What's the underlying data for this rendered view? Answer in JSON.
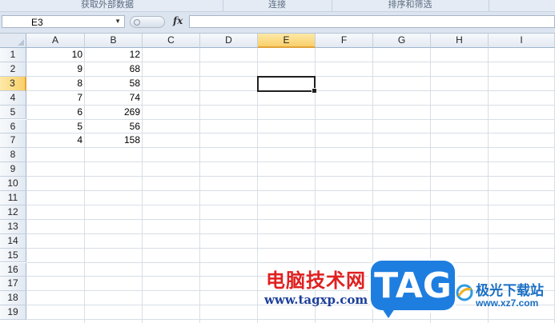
{
  "ribbon": {
    "groups": [
      "获取外部数据",
      "连接",
      "排序和筛选"
    ]
  },
  "formula_bar": {
    "name_box": "E3",
    "fx_label": "fx",
    "formula": ""
  },
  "sheet": {
    "columns": [
      "A",
      "B",
      "C",
      "D",
      "E",
      "F",
      "G",
      "H",
      "I"
    ],
    "rows": [
      "1",
      "2",
      "3",
      "4",
      "5",
      "6",
      "7",
      "8",
      "9",
      "10",
      "11",
      "12",
      "13",
      "14",
      "15",
      "16",
      "17",
      "18",
      "19"
    ],
    "selected_cell": "E3",
    "cells": {
      "A": [
        "10",
        "9",
        "8",
        "7",
        "6",
        "5",
        "4"
      ],
      "B": [
        "12",
        "68",
        "58",
        "74",
        "269",
        "56",
        "158"
      ]
    }
  },
  "watermark": {
    "site_cn": "电脑技术网",
    "site_url": "www.tagxp.com",
    "logo_text": "TAG",
    "xz_name": "极光下载站",
    "xz_url": "www.xz7.com"
  },
  "colors": {
    "selected_header": "#f9cf6a",
    "header_bg": "#e3e9f2",
    "gridline": "#d8dee6",
    "logo_blue": "#1e7ee0"
  }
}
